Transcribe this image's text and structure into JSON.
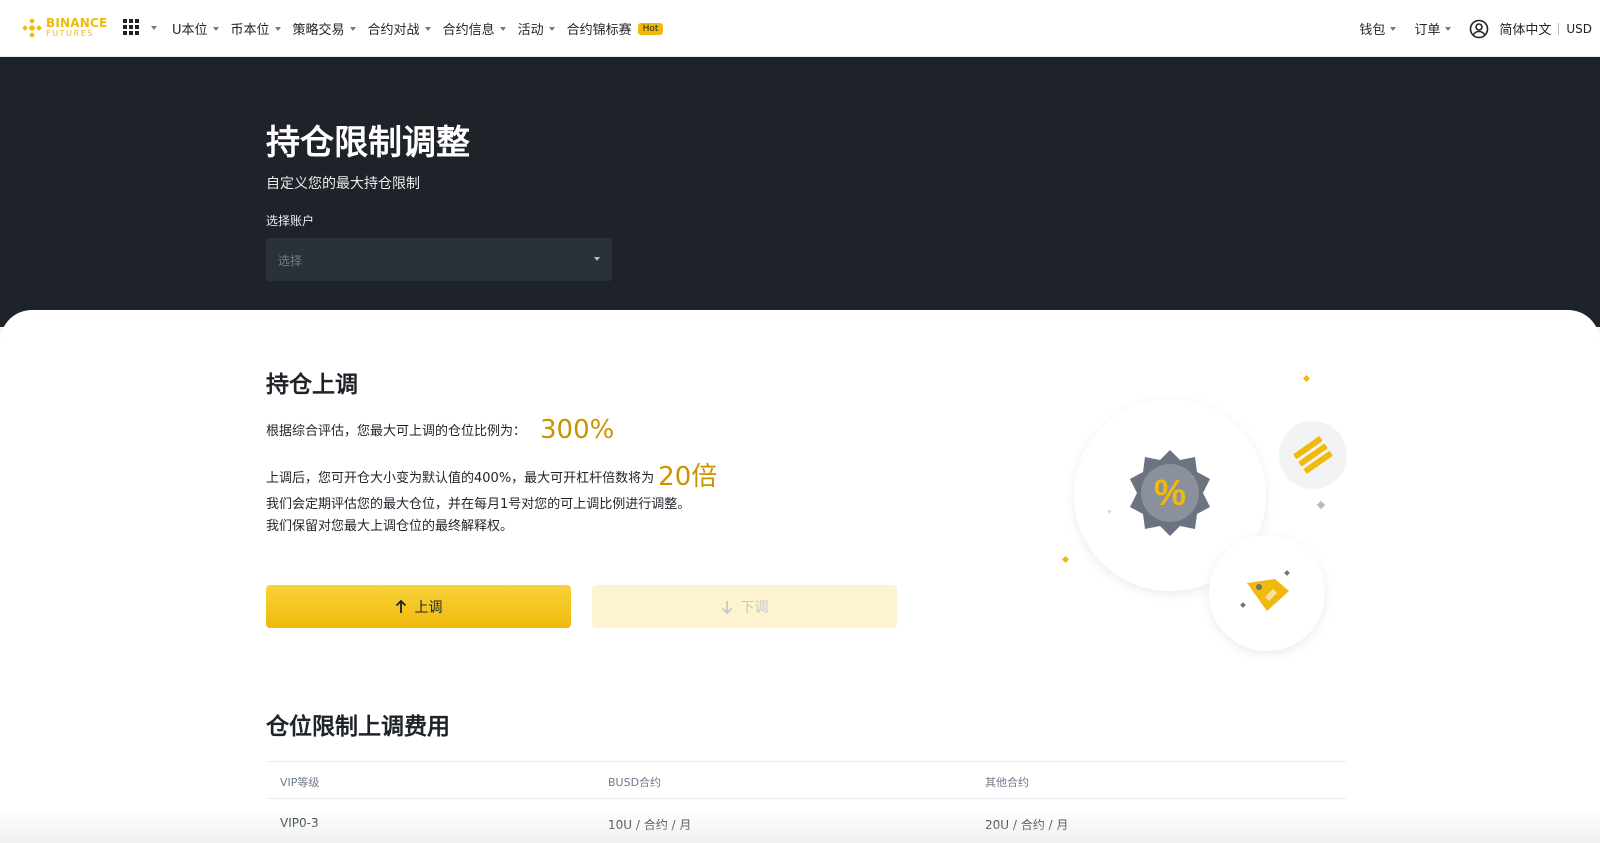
{
  "nav": {
    "logo_line1": "BINANCE",
    "logo_line2": "FUTURES",
    "items": [
      "U本位",
      "币本位",
      "策略交易",
      "合约对战",
      "合约信息",
      "活动",
      "合约锦标赛"
    ],
    "hot_badge": "Hot",
    "wallet": "钱包",
    "orders": "订单",
    "language": "简体中文",
    "currency": "USD"
  },
  "hero": {
    "title": "持仓限制调整",
    "subtitle": "自定义您的最大持仓限制",
    "account_label": "选择账户",
    "account_placeholder": "选择"
  },
  "increase": {
    "title": "持仓上调",
    "ratio_text": "根据综合评估，您最大可上调的仓位比例为：",
    "ratio_value": "300%",
    "after_text": "上调后，您可开仓大小变为默认值的400%，最大可开杠杆倍数将为",
    "leverage_value": "20倍",
    "note1": "我们会定期评估您的最大仓位，并在每月1号对您的可上调比例进行调整。",
    "note2": "我们保留对您最大上调仓位的最终解释权。",
    "up_button": "上调",
    "down_button": "下调"
  },
  "fees": {
    "title": "仓位限制上调费用",
    "headers": [
      "VIP等级",
      "BUSD合约",
      "其他合约"
    ],
    "rows": [
      [
        "VIP0-3",
        "10U / 合约 / 月",
        "20U / 合约 / 月"
      ]
    ]
  },
  "colors": {
    "brand": "#f0b90b",
    "dark": "#1e2329",
    "accent_text": "#c99400"
  }
}
